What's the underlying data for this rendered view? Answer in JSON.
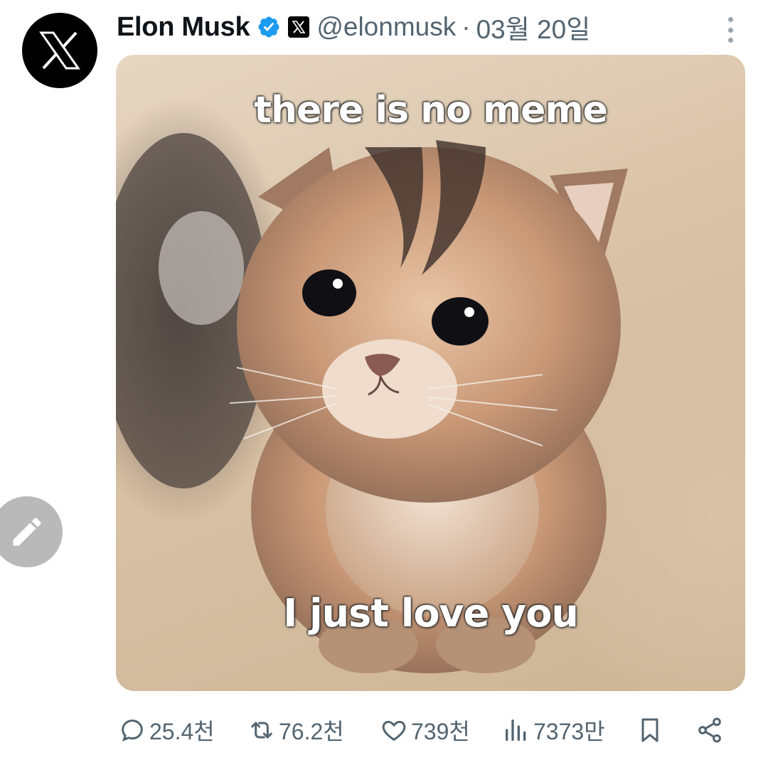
{
  "tweet": {
    "author": {
      "name": "Elon Musk",
      "handle": "@elonmusk",
      "avatar_icon": "x-logo-icon",
      "verified_icon": "verified-badge-icon",
      "affiliation_icon": "x-affiliation-icon"
    },
    "separator": "·",
    "date": "03월 20일",
    "media": {
      "top_caption": "there is no meme",
      "bottom_caption": "I just love you"
    },
    "stats": {
      "replies": "25.4천",
      "reposts": "76.2천",
      "likes": "739천",
      "views": "7373만"
    }
  },
  "colors": {
    "verified_blue": "#1d9bf0",
    "secondary_text": "#536471",
    "primary_text": "#0f1419",
    "fab_gray": "#b9b9b9"
  }
}
